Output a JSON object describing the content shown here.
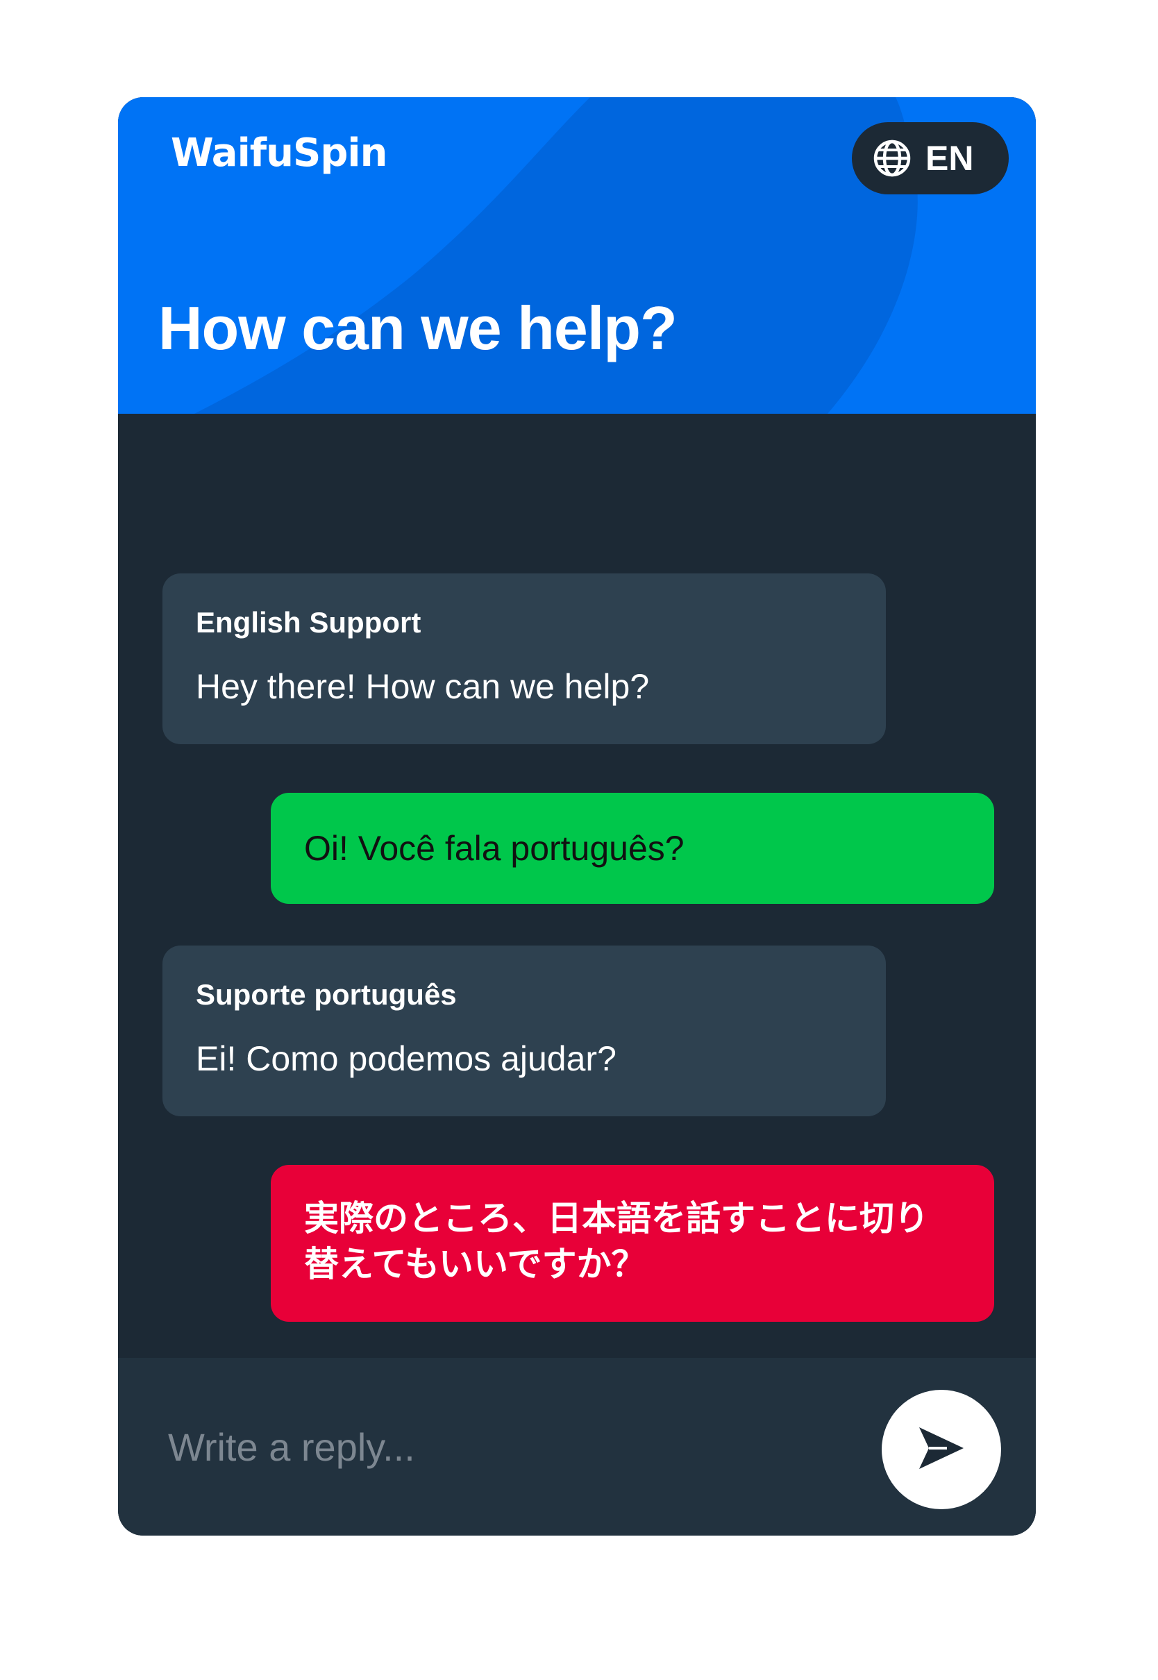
{
  "colors": {
    "header_blue": "#0073f5",
    "panel_dark": "#1c2935",
    "agent_bubble": "#2e4150",
    "user_green": "#00c74b",
    "user_red": "#e80038",
    "composer": "#22323f"
  },
  "header": {
    "brand": "WaifuSpin",
    "language_button": {
      "icon": "globe-icon",
      "label": "EN"
    },
    "title": "How can we help?"
  },
  "messages": [
    {
      "role": "agent",
      "sender": "English Support",
      "text": "Hey there! How can we help?"
    },
    {
      "role": "user",
      "text": "Oi! Você fala português?"
    },
    {
      "role": "agent",
      "sender": "Suporte português",
      "text": "Ei! Como podemos ajudar?"
    },
    {
      "role": "user",
      "text": "実際のところ、日本語を話すことに切り替えてもいいですか？"
    }
  ],
  "composer": {
    "placeholder": "Write a reply...",
    "value": "",
    "send_icon": "send-icon"
  }
}
